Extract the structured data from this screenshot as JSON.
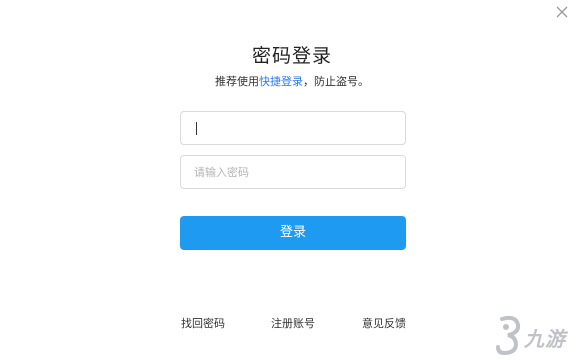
{
  "dialog": {
    "title": "密码登录",
    "subtitle_prefix": "推荐使用",
    "subtitle_link": "快捷登录",
    "subtitle_suffix": "，防止盗号。"
  },
  "form": {
    "account_value": "",
    "password_placeholder": "请输入密码",
    "submit_label": "登录"
  },
  "footer": {
    "recover_label": "找回密码",
    "register_label": "注册账号",
    "feedback_label": "意见反馈"
  },
  "watermark": {
    "text": "九游"
  },
  "colors": {
    "accent": "#1e9bf0",
    "link": "#2a7be4"
  },
  "icons": {
    "close": "close-icon",
    "logo": "jiuyou-logo-icon"
  }
}
